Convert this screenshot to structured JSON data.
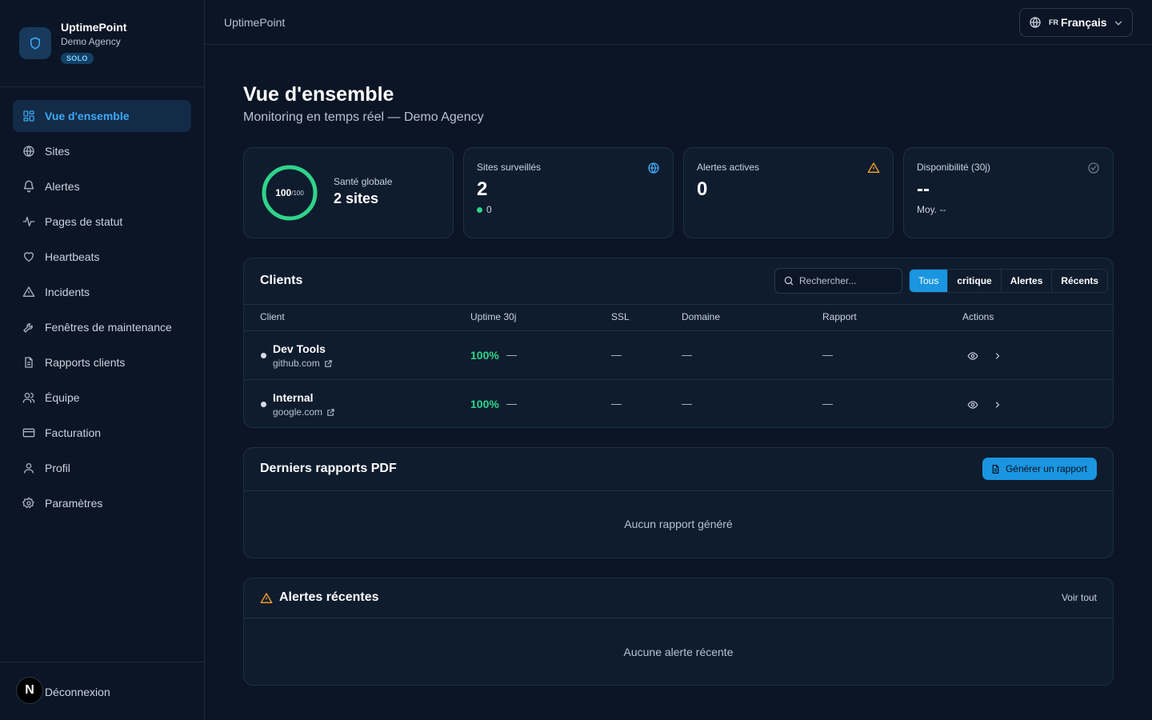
{
  "brand": {
    "name": "UptimePoint",
    "org": "Demo Agency",
    "plan": "SOLO"
  },
  "nav": [
    {
      "label": "Vue d'ensemble",
      "icon": "grid-icon",
      "active": true
    },
    {
      "label": "Sites",
      "icon": "globe-icon"
    },
    {
      "label": "Alertes",
      "icon": "bell-icon"
    },
    {
      "label": "Pages de statut",
      "icon": "activity-icon"
    },
    {
      "label": "Heartbeats",
      "icon": "heart-icon"
    },
    {
      "label": "Incidents",
      "icon": "warning-icon"
    },
    {
      "label": "Fenêtres de maintenance",
      "icon": "wrench-icon"
    },
    {
      "label": "Rapports clients",
      "icon": "file-icon"
    },
    {
      "label": "Équipe",
      "icon": "users-icon"
    },
    {
      "label": "Facturation",
      "icon": "credit-card-icon"
    },
    {
      "label": "Profil",
      "icon": "user-icon"
    },
    {
      "label": "Paramètres",
      "icon": "gear-icon"
    }
  ],
  "footer": {
    "avatar_letter": "N",
    "logout": "Déconnexion"
  },
  "topbar": {
    "title": "UptimePoint",
    "lang_code": "FR",
    "lang_label": "Français"
  },
  "header": {
    "title": "Vue d'ensemble",
    "subtitle": "Monitoring en temps réel — Demo Agency"
  },
  "stats": {
    "health": {
      "score": "100",
      "max": "/100",
      "score_value": 100,
      "label": "Santé globale",
      "value": "2 sites"
    },
    "sites": {
      "label": "Sites surveillés",
      "value": "2",
      "sub": "0"
    },
    "alerts": {
      "label": "Alertes actives",
      "value": "0"
    },
    "availability": {
      "label": "Disponibilité (30j)",
      "value": "--",
      "sub": "Moy. --"
    }
  },
  "clients": {
    "title": "Clients",
    "search_placeholder": "Rechercher...",
    "filters": [
      "Tous",
      "critique",
      "Alertes",
      "Récents"
    ],
    "columns": [
      "Client",
      "Uptime 30j",
      "SSL",
      "Domaine",
      "Rapport",
      "Actions"
    ],
    "rows": [
      {
        "name": "Dev Tools",
        "url": "github.com",
        "uptime": "100%",
        "uptime_extra": "—",
        "ssl": "—",
        "domain": "—",
        "report": "—"
      },
      {
        "name": "Internal",
        "url": "google.com",
        "uptime": "100%",
        "uptime_extra": "—",
        "ssl": "—",
        "domain": "—",
        "report": "—"
      }
    ]
  },
  "reports": {
    "title": "Derniers rapports PDF",
    "button": "Générer un rapport",
    "empty": "Aucun rapport généré"
  },
  "recent_alerts": {
    "title": "Alertes récentes",
    "link": "Voir tout",
    "empty": "Aucune alerte récente"
  },
  "colors": {
    "background": "#0b1525",
    "card": "#0f1c2e",
    "accent": "#1a95e0",
    "success": "#2fd48a",
    "warning": "#f5a524"
  }
}
